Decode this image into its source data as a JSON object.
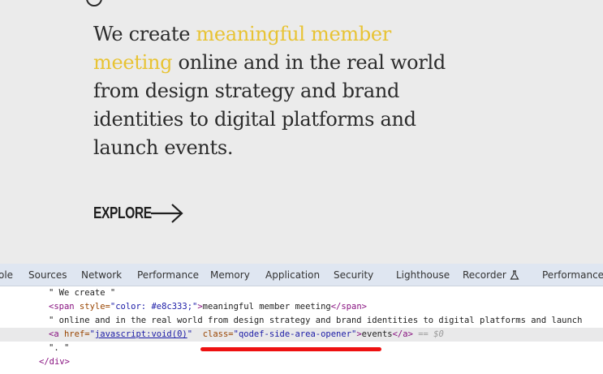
{
  "hero": {
    "text_before": "We create ",
    "text_highlight": "meaningful member meeting",
    "text_after": " online and in the real world from design strategy and brand identities to digital platforms and launch events.",
    "highlight_color": "#e8c333"
  },
  "explore": {
    "label": "EXPLORE",
    "icon": "arrow-right-icon"
  },
  "devtools": {
    "tabs": [
      "ole",
      "Sources",
      "Network",
      "Performance",
      "Memory",
      "Application",
      "Security",
      "Lighthouse",
      "Recorder",
      "Performance in"
    ],
    "recorder_icon": "flask-icon"
  },
  "code": {
    "line1": "\" We create \"",
    "line2_open_tag": "<span",
    "line2_attr": " style=",
    "line2_val": "\"color: #e8c333;\"",
    "line2_close": ">",
    "line2_text": "meaningful member meeting",
    "line2_end_tag": "</span>",
    "line3": "\" online and in the real world from design strategy and brand identities to digital platforms and launch",
    "line4_open_tag": "<a",
    "line4_href_attr": " href=",
    "line4_href_quote_open": "\"",
    "line4_href_val": "javascript:void(0)",
    "line4_href_quote_close": "\"",
    "line4_class_attr": "  class=",
    "line4_class_val": "\"qodef-side-area-opener\"",
    "line4_close": ">",
    "line4_text": "events",
    "line4_end_tag": "</a>",
    "line4_eq": " == $0",
    "line5": "\". \"",
    "line6": "</div>",
    "underline_color": "#ee1111"
  }
}
